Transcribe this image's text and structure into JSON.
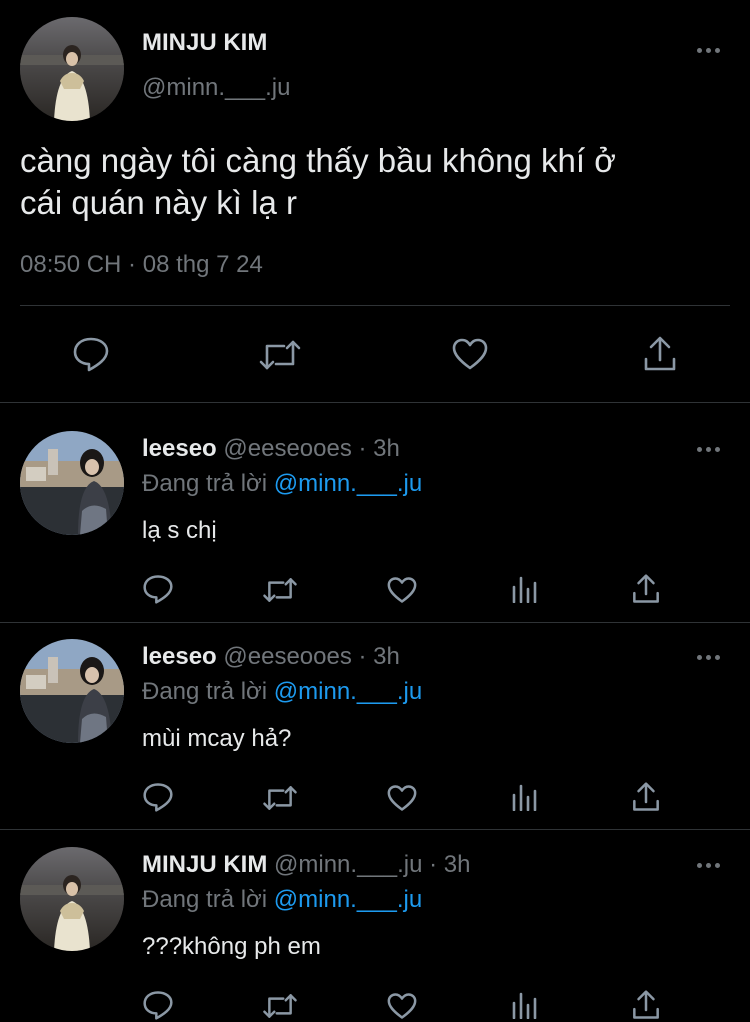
{
  "colors": {
    "background": "#000000",
    "text": "#e7e9ea",
    "muted": "#71767b",
    "link": "#1d9bf0",
    "divider": "#2f3336"
  },
  "main_tweet": {
    "display_name": "MINJU KIM",
    "handle": "@minn.___.ju",
    "text_line1": "càng ngày tôi càng thấy bầu không khí ở",
    "text_line2": "cái quán này kì lạ r",
    "timestamp": "08:50 CH · 08 thg 7 24",
    "actions": [
      "reply-icon",
      "retweet-icon",
      "like-icon",
      "share-icon"
    ]
  },
  "replies": [
    {
      "display_name": "leeseo",
      "handle": "@eeseooes",
      "time": "· 3h",
      "replying_prefix": "Đang trả lời",
      "replying_to": "@minn.___.ju",
      "text": "lạ s chị"
    },
    {
      "display_name": "leeseo",
      "handle": "@eeseooes",
      "time": "· 3h",
      "replying_prefix": "Đang trả lời",
      "replying_to": "@minn.___.ju",
      "text": "mùi mcay hả?"
    },
    {
      "display_name": "MINJU KIM",
      "handle": "@minn.___.ju",
      "time": "· 3h",
      "replying_prefix": "Đang trả lời",
      "replying_to": "@minn.___.ju",
      "text": "???không ph em"
    }
  ]
}
